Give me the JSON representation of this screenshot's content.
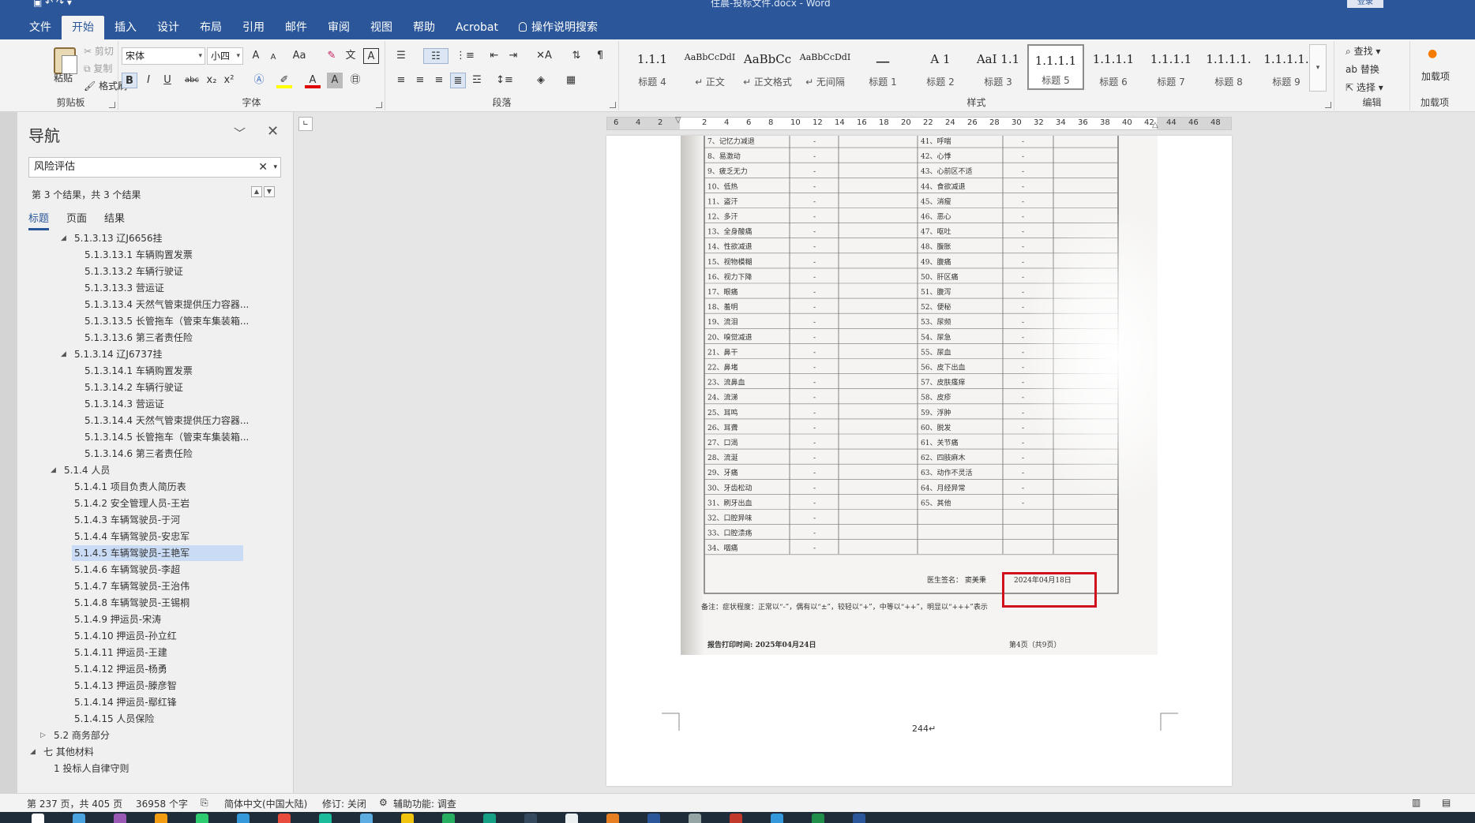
{
  "window": {
    "title": "住晨-投标文件.docx  -  Word",
    "login_label": "登录"
  },
  "ribbon_tabs": [
    "文件",
    "开始",
    "插入",
    "设计",
    "布局",
    "引用",
    "邮件",
    "审阅",
    "视图",
    "帮助",
    "Acrobat",
    "操作说明搜索"
  ],
  "active_tab": "开始",
  "clipboard": {
    "paste": "粘贴",
    "cut": "剪切",
    "copy": "复制",
    "format_painter": "格式刷",
    "group_label": "剪贴板"
  },
  "font": {
    "name": "宋体",
    "size": "小四",
    "case_label": "Aa",
    "group_label": "字体",
    "bold": "B",
    "italic": "I",
    "underline": "U",
    "strike": "abc",
    "sub": "x₂",
    "sup": "x²",
    "font_color_label": "A",
    "clear_format_label": "A",
    "char_border_label": "A",
    "grow_label": "A",
    "shrink_label": "A"
  },
  "paragraph": {
    "group_label": "段落"
  },
  "styles": {
    "group_label": "样式",
    "items": [
      {
        "preview": "1.1.1",
        "name": "标题 4"
      },
      {
        "preview": "AaBbCcDdI",
        "name": "↵ 正文"
      },
      {
        "preview": "AaBbCc",
        "name": "↵ 正文格式"
      },
      {
        "preview": "AaBbCcDdI",
        "name": "↵ 无间隔"
      },
      {
        "preview": "一",
        "name": "标题 1"
      },
      {
        "preview": "A 1",
        "name": "标题 2"
      },
      {
        "preview": "AaI 1.1",
        "name": "标题 3"
      },
      {
        "preview": "1.1.1.1",
        "name": "标题 5"
      },
      {
        "preview": "1.1.1.1",
        "name": "标题 6"
      },
      {
        "preview": "1.1.1.1",
        "name": "标题 7"
      },
      {
        "preview": "1.1.1.1.",
        "name": "标题 8"
      },
      {
        "preview": "1.1.1.1.",
        "name": "标题 9"
      }
    ],
    "selected": "标题 5"
  },
  "editing": {
    "find": "查找",
    "replace": "替换",
    "select": "选择",
    "group_label": "编辑"
  },
  "addins": {
    "label": "加载项",
    "group_label": "加载项"
  },
  "navigation": {
    "title": "导航",
    "search_value": "风险评估",
    "result_count": "第 3 个结果，共 3 个结果",
    "tabs": [
      "标题",
      "页面",
      "结果"
    ],
    "active_tab": "标题",
    "tree": [
      {
        "text": "5.1.3.13 辽J6656挂",
        "level": 3,
        "toggle": "◢"
      },
      {
        "text": "5.1.3.13.1 车辆购置发票",
        "level": 4
      },
      {
        "text": "5.1.3.13.2 车辆行驶证",
        "level": 4
      },
      {
        "text": "5.1.3.13.3 营运证",
        "level": 4
      },
      {
        "text": "5.1.3.13.4 天然气管束提供压力容器...",
        "level": 4
      },
      {
        "text": "5.1.3.13.5 长管拖车（管束车集装箱...",
        "level": 4
      },
      {
        "text": "5.1.3.13.6 第三者责任险",
        "level": 4
      },
      {
        "text": "5.1.3.14 辽J6737挂",
        "level": 3,
        "toggle": "◢"
      },
      {
        "text": "5.1.3.14.1 车辆购置发票",
        "level": 4
      },
      {
        "text": "5.1.3.14.2 车辆行驶证",
        "level": 4
      },
      {
        "text": "5.1.3.14.3 营运证",
        "level": 4
      },
      {
        "text": "5.1.3.14.4 天然气管束提供压力容器...",
        "level": 4
      },
      {
        "text": "5.1.3.14.5 长管拖车（管束车集装箱...",
        "level": 4
      },
      {
        "text": "5.1.3.14.6 第三者责任险",
        "level": 4
      },
      {
        "text": "5.1.4 人员",
        "level": 2,
        "toggle": "◢"
      },
      {
        "text": "5.1.4.1 项目负责人简历表",
        "level": 3
      },
      {
        "text": "5.1.4.2 安全管理人员-王岩",
        "level": 3
      },
      {
        "text": "5.1.4.3 车辆驾驶员-于河",
        "level": 3
      },
      {
        "text": "5.1.4.4 车辆驾驶员-安忠军",
        "level": 3
      },
      {
        "text": "5.1.4.5 车辆驾驶员-王艳军",
        "level": 3,
        "selected": true
      },
      {
        "text": "5.1.4.6 车辆驾驶员-李超",
        "level": 3
      },
      {
        "text": "5.1.4.7 车辆驾驶员-王治伟",
        "level": 3
      },
      {
        "text": "5.1.4.8 车辆驾驶员-王锡桐",
        "level": 3
      },
      {
        "text": "5.1.4.9 押运员-宋涛",
        "level": 3
      },
      {
        "text": "5.1.4.10 押运员-孙立红",
        "level": 3
      },
      {
        "text": "5.1.4.11 押运员-王建",
        "level": 3
      },
      {
        "text": "5.1.4.12 押运员-杨勇",
        "level": 3
      },
      {
        "text": "5.1.4.13 押运员-滕彦智",
        "level": 3
      },
      {
        "text": "5.1.4.14 押运员-鄢红锋",
        "level": 3
      },
      {
        "text": "5.1.4.15 人员保险",
        "level": 3
      },
      {
        "text": "5.2 商务部分",
        "level": 1,
        "toggle": "▷"
      },
      {
        "text": "七 其他材料",
        "level": 0,
        "toggle": "◢"
      },
      {
        "text": "1 投标人自律守则",
        "level": 1
      }
    ]
  },
  "ruler": {
    "numbers": [
      "6",
      "4",
      "2",
      "",
      "2",
      "4",
      "6",
      "8",
      "10",
      "12",
      "14",
      "16",
      "18",
      "20",
      "22",
      "24",
      "26",
      "28",
      "30",
      "32",
      "34",
      "36",
      "38",
      "40",
      "42",
      "44",
      "46",
      "48"
    ]
  },
  "scan": {
    "left_col": [
      "7、记忆力减退",
      "8、易激动",
      "9、疲乏无力",
      "10、低热",
      "11、盗汗",
      "12、多汗",
      "13、全身酸痛",
      "14、性欲减退",
      "15、视物模糊",
      "16、视力下降",
      "17、眼痛",
      "18、羞明",
      "19、流泪",
      "20、嗅觉减退",
      "21、鼻干",
      "22、鼻堵",
      "23、流鼻血",
      "24、流涕",
      "25、耳鸣",
      "26、耳聋",
      "27、口渴",
      "28、流涎",
      "29、牙痛",
      "30、牙齿松动",
      "31、刷牙出血",
      "32、口腔异味",
      "33、口腔溃疡",
      "34、咽痛"
    ],
    "right_col": [
      "41、呼喘",
      "42、心悸",
      "43、心前区不适",
      "44、食欲减退",
      "45、消瘦",
      "46、恶心",
      "47、呕吐",
      "48、腹胀",
      "49、腹痛",
      "50、肝区痛",
      "51、腹泻",
      "52、便秘",
      "53、尿频",
      "54、尿急",
      "55、尿血",
      "56、皮下出血",
      "57、皮肤瘙痒",
      "58、皮疹",
      "59、浮肿",
      "60、脱发",
      "61、关节痛",
      "62、四肢麻木",
      "63、动作不灵活",
      "64、月经异常",
      "65、其他"
    ],
    "mark": "-",
    "doctor_label": "医生签名：",
    "doctor_name": "窦美秉",
    "date": "2024年04月18日",
    "note": "备注：症状程度：正常以“-”，偶有以“±”，较轻以“+”，中等以“++”，明显以“+++”表示",
    "print_time": "报告打印时间: 2025年04月24日",
    "page_info": "第4页（共9页）"
  },
  "page_number_text": "244↵",
  "status": {
    "page": "第 237 页，共 405 页",
    "words": "36958 个字",
    "language": "简体中文(中国大陆)",
    "track": "修订: 关闭",
    "accessibility": "辅助功能: 调查"
  },
  "colors": {
    "accent": "#2b579a",
    "highlight_box": "#d0101c",
    "selection": "#c9dbf5"
  }
}
